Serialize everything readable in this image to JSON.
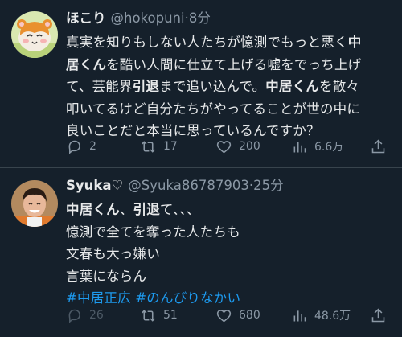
{
  "tweets": [
    {
      "name": "ほこり",
      "handle": "@hokopuni",
      "dot": "·",
      "time": "8分",
      "lines": [
        [
          "真実を知りもしない人たちが憶測でもっと悪く",
          "中"
        ],
        [
          "居くん",
          "を酷い人間に仕立て上げる嘘をでっち上げ"
        ],
        [
          "て、芸能界",
          "引退",
          "まで追い込んで。",
          "中居くん",
          "を散々"
        ],
        [
          "叩いてるけど自分たちがやってることが世の中に"
        ],
        [
          "良いことだと本当に思っているんですか？"
        ]
      ],
      "stats": {
        "replies": "2",
        "retweets": "17",
        "likes": "200",
        "views": "6.6万"
      }
    },
    {
      "name": "Syuka♡",
      "handle": "@Syuka86787903",
      "dot": "·",
      "time": "25分",
      "lines": [
        [
          "中居くん",
          "、",
          "引退",
          "て、、、"
        ],
        [
          "憶測で全てを奪った人たちも"
        ],
        [
          "文春も大っ嫌い"
        ],
        [
          "言葉にならん"
        ],
        [
          "#中居正広",
          " ",
          "#のんびりなかい"
        ]
      ],
      "stats": {
        "replies": "26",
        "retweets": "51",
        "likes": "680",
        "views": "48.6万"
      }
    }
  ],
  "colors": {
    "background": "#15202b",
    "text": "#e7e9ea",
    "muted": "#8b98a5",
    "link": "#1d9bf0",
    "divider": "#38444d"
  },
  "icons": [
    "reply-icon",
    "retweet-icon",
    "like-icon",
    "views-icon",
    "share-icon"
  ]
}
